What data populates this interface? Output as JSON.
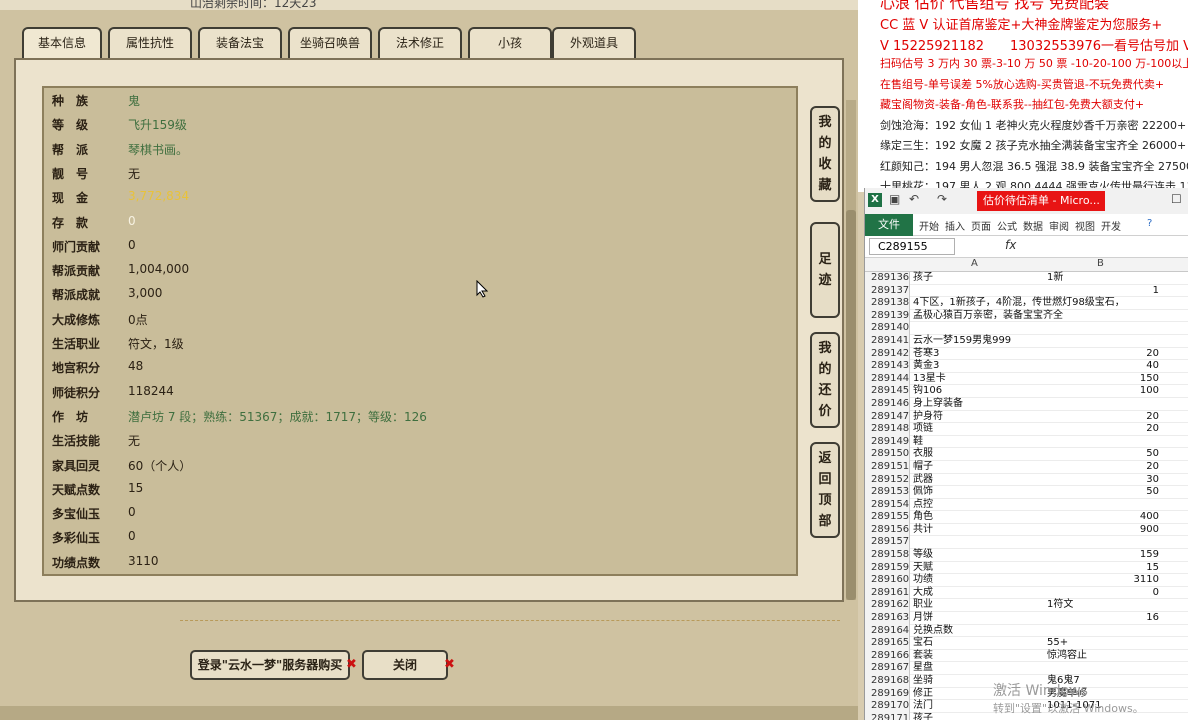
{
  "game": {
    "top_text": "山治剩余时间：12天23",
    "tabs": [
      "基本信息",
      "属性抗性",
      "装备法宝",
      "坐骑召唤兽",
      "法术修正",
      "小孩",
      "外观道具"
    ],
    "rows": [
      {
        "label": "种　族",
        "value": "鬼",
        "style": "green"
      },
      {
        "label": "等　级",
        "value": "飞升159级",
        "style": "green"
      },
      {
        "label": "帮　派",
        "value": "琴棋书画。",
        "style": "green"
      },
      {
        "label": "靓　号",
        "value": "无",
        "style": "dark"
      },
      {
        "label": "现　金",
        "value": "3,772,834",
        "style": "gold"
      },
      {
        "label": "存　款",
        "value": "0",
        "style": "white"
      },
      {
        "label": "师门贡献",
        "value": "0",
        "style": "dark"
      },
      {
        "label": "帮派贡献",
        "value": "1,004,000",
        "style": "dark"
      },
      {
        "label": "帮派成就",
        "value": "3,000",
        "style": "dark"
      },
      {
        "label": "大成修炼",
        "value": "0点",
        "style": "dark"
      },
      {
        "label": "生活职业",
        "value": "符文，1级",
        "style": "dark"
      },
      {
        "label": "地宫积分",
        "value": "48",
        "style": "dark"
      },
      {
        "label": "师徒积分",
        "value": "118244",
        "style": "dark"
      },
      {
        "label": "作　坊",
        "value": "潜卢坊 7 段；熟练：51367；成就：1717；等级：126",
        "style": "green"
      },
      {
        "label": "生活技能",
        "value": "无",
        "style": "dark"
      },
      {
        "label": "家具回灵",
        "value": "60（个人）",
        "style": "dark"
      },
      {
        "label": "天赋点数",
        "value": "15",
        "style": "dark"
      },
      {
        "label": "多宝仙玉",
        "value": "0",
        "style": "dark"
      },
      {
        "label": "多彩仙玉",
        "value": "0",
        "style": "dark"
      },
      {
        "label": "功绩点数",
        "value": "3110",
        "style": "dark"
      }
    ],
    "side_buttons": [
      {
        "id": "favorites",
        "chars": [
          "我",
          "的",
          "收",
          "藏"
        ]
      },
      {
        "id": "footprints",
        "chars": [
          "足",
          "迹"
        ]
      },
      {
        "id": "counter-offer",
        "chars": [
          "我",
          "的",
          "还",
          "价"
        ]
      },
      {
        "id": "back-to-top",
        "chars": [
          "返",
          "回",
          "顶",
          "部"
        ]
      }
    ],
    "login_button": "登录\"云水一梦\"服务器购买",
    "close_button": "关闭",
    "x_mark": "✖"
  },
  "overlay": {
    "lines": [
      {
        "text": "心浪 估价 代售组号 找号 免费配装",
        "color": "red"
      },
      {
        "text": "CC 蓝 V 认证首席鉴定+大神金牌鉴定为您服务+",
        "color": "red"
      },
      {
        "text": "V 15225921182　　13032553976一看号估号加 V",
        "color": "red"
      },
      {
        "text": "扫码估号 3 万内 30 票-3-10 万 50 票 -10-20-100 万-100以上 150",
        "color": "red"
      },
      {
        "text": "在售组号-单号误差 5%放心选购-买贵管退-不玩免费代卖+",
        "color": "red"
      },
      {
        "text": "藏宝阁物资-装备-角色-联系我--抽红包-免费大额支付+",
        "color": "red"
      },
      {
        "text": "剑蚀沧海：192 女仙 1 老神火克火程度妙香千万亲密 22200+",
        "color": "dark"
      },
      {
        "text": "缘定三生：192 女魔 2 孩子克水抽全满装备宝宝齐全 26000+",
        "color": "dark"
      },
      {
        "text": "红颜知己：194 男人忽混 36.5 强混 38.9 装备宝宝齐全 27500+",
        "color": "dark"
      },
      {
        "text": "十里桃花：197 男人 2 观 800 4444 强雷克火传世最行连击 11",
        "color": "dark"
      }
    ]
  },
  "excel": {
    "logo": "X",
    "window_title": "估价待估清单 - Micro...",
    "file_tab": "文件",
    "ribbon_tabs": [
      "开始",
      "插入",
      "页面",
      "公式",
      "数据",
      "审阅",
      "视图",
      "开发"
    ],
    "name_box": "C289155",
    "fx": "fx",
    "col_a": "A",
    "col_b": "B",
    "rows": [
      {
        "n": "289136",
        "a": "孩子",
        "b": "1新"
      },
      {
        "n": "289137",
        "a": "",
        "b": "1"
      },
      {
        "n": "289138",
        "a": "4下区，1新孩子，4阶混，传世燃灯98级宝石，",
        "b": ""
      },
      {
        "n": "289139",
        "a": "孟极心猿百万亲密，装备宝宝齐全",
        "b": ""
      },
      {
        "n": "289140",
        "a": "",
        "b": ""
      },
      {
        "n": "289141",
        "a": "云水一梦159男鬼999",
        "b": ""
      },
      {
        "n": "289142",
        "a": "苍寒3",
        "b": "20"
      },
      {
        "n": "289143",
        "a": "黄金3",
        "b": "40"
      },
      {
        "n": "289144",
        "a": "13星卡",
        "b": "150"
      },
      {
        "n": "289145",
        "a": "钩106",
        "b": "100"
      },
      {
        "n": "289146",
        "a": "身上穿装备",
        "b": ""
      },
      {
        "n": "289147",
        "a": "护身符",
        "b": "20"
      },
      {
        "n": "289148",
        "a": "项链",
        "b": "20"
      },
      {
        "n": "289149",
        "a": "鞋",
        "b": ""
      },
      {
        "n": "289150",
        "a": "衣服",
        "b": "50"
      },
      {
        "n": "289151",
        "a": "帽子",
        "b": "20"
      },
      {
        "n": "289152",
        "a": "武器",
        "b": "30"
      },
      {
        "n": "289153",
        "a": "佩饰",
        "b": "50"
      },
      {
        "n": "289154",
        "a": "点控",
        "b": ""
      },
      {
        "n": "289155",
        "a": "角色",
        "b": "400"
      },
      {
        "n": "289156",
        "a": "共计",
        "b": "900"
      },
      {
        "n": "289157",
        "a": "",
        "b": ""
      },
      {
        "n": "289158",
        "a": "等级",
        "b": "159"
      },
      {
        "n": "289159",
        "a": "天赋",
        "b": "15"
      },
      {
        "n": "289160",
        "a": "功绩",
        "b": "3110"
      },
      {
        "n": "289161",
        "a": "大成",
        "b": "0"
      },
      {
        "n": "289162",
        "a": "职业",
        "b": "1符文"
      },
      {
        "n": "289163",
        "a": "月饼",
        "b": "16"
      },
      {
        "n": "289164",
        "a": "兑换点数",
        "b": ""
      },
      {
        "n": "289165",
        "a": "宝石",
        "b": "55+"
      },
      {
        "n": "289166",
        "a": "套装",
        "b": "惊鸿容止"
      },
      {
        "n": "289167",
        "a": "星盘",
        "b": ""
      },
      {
        "n": "289168",
        "a": "坐骑",
        "b": "鬼6鬼7"
      },
      {
        "n": "289169",
        "a": "修正",
        "b": "男魔单修"
      },
      {
        "n": "289170",
        "a": "法门",
        "b": "1011-1071"
      },
      {
        "n": "289171",
        "a": "孩子",
        "b": ""
      }
    ],
    "watermark": "激活 Windows",
    "watermark_sub": "转到\"设置\"以激活 Windows。"
  }
}
